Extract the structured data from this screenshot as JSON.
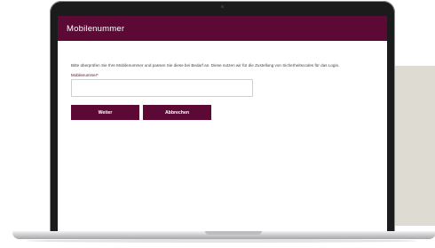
{
  "app": {
    "title": "Mobilenummer"
  },
  "form": {
    "info_text": "Bitte überprüfen Sie Ihre Mobilenummer und passen Sie diese bei Bedarf an. Diese nutzen wir für die Zustellung von Sicherheitscodes für das Login.",
    "field_label": "Mobilenummer*",
    "field_value": "",
    "next_label": "Weiter",
    "cancel_label": "Abbrechen"
  },
  "colors": {
    "brand": "#5c0a35",
    "panel": "#dedbd2",
    "lid": "#1b1b1c"
  }
}
